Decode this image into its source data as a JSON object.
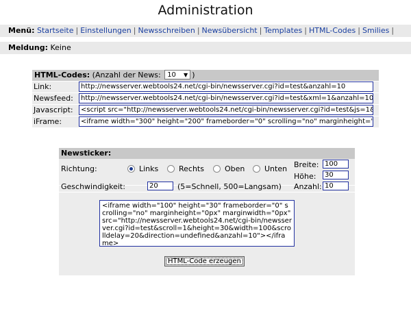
{
  "title": "Administration",
  "menu": {
    "label": "Menü:",
    "items": [
      "Startseite",
      "Einstellungen",
      "Newsschreiben",
      "Newsübersicht",
      "Templates",
      "HTML-Codes",
      "Smilies"
    ]
  },
  "message": {
    "label": "Meldung:",
    "value": "Keine"
  },
  "codes": {
    "title": "HTML-Codes:",
    "count_label_prefix": "(Anzahl der News:",
    "count_value": "10",
    "count_label_suffix": ")",
    "rows": [
      {
        "label": "Link:",
        "value": "http://newsserver.webtools24.net/cgi-bin/newsserver.cgi?id=test&anzahl=10"
      },
      {
        "label": "Newsfeed:",
        "value": "http://newsserver.webtools24.net/cgi-bin/newsserver.cgi?id=test&xml=1&anzahl=10"
      },
      {
        "label": "Javascript:",
        "value": "<script src=\"http://newsserver.webtools24.net/cgi-bin/newsserver.cgi?id=test&js=1&a"
      },
      {
        "label": "iFrame:",
        "value": "<iframe width=\"300\" height=\"200\" frameborder=\"0\" scrolling=\"no\" marginheight=\"0px"
      }
    ]
  },
  "ticker": {
    "title": "Newsticker:",
    "direction_label": "Richtung:",
    "directions": [
      "Links",
      "Rechts",
      "Oben",
      "Unten"
    ],
    "selected_direction": "Links",
    "width_label": "Breite:",
    "width_value": "100",
    "height_label": "Höhe:",
    "height_value": "30",
    "speed_label": "Geschwindigkeit:",
    "speed_value": "20",
    "speed_hint": "(5=Schnell, 500=Langsam)",
    "count_label": "Anzahl:",
    "count_value": "10",
    "code": "<iframe width=\"100\" height=\"30\" frameborder=\"0\" scrolling=\"no\" marginheight=\"0px\" marginwidth=\"0px\" src=\"http://newsserver.webtools24.net/cgi-bin/newsserver.cgi?id=test&scroll=1&height=30&width=100&scrolldelay=20&direction=undefined&anzahl=10\"></iframe>",
    "button_label": "HTML-Code erzeugen"
  },
  "colors": {
    "link": "#1a3fa0",
    "border": "#2030a0",
    "bar": "#e9e9e9",
    "header": "#c8c8c8"
  }
}
